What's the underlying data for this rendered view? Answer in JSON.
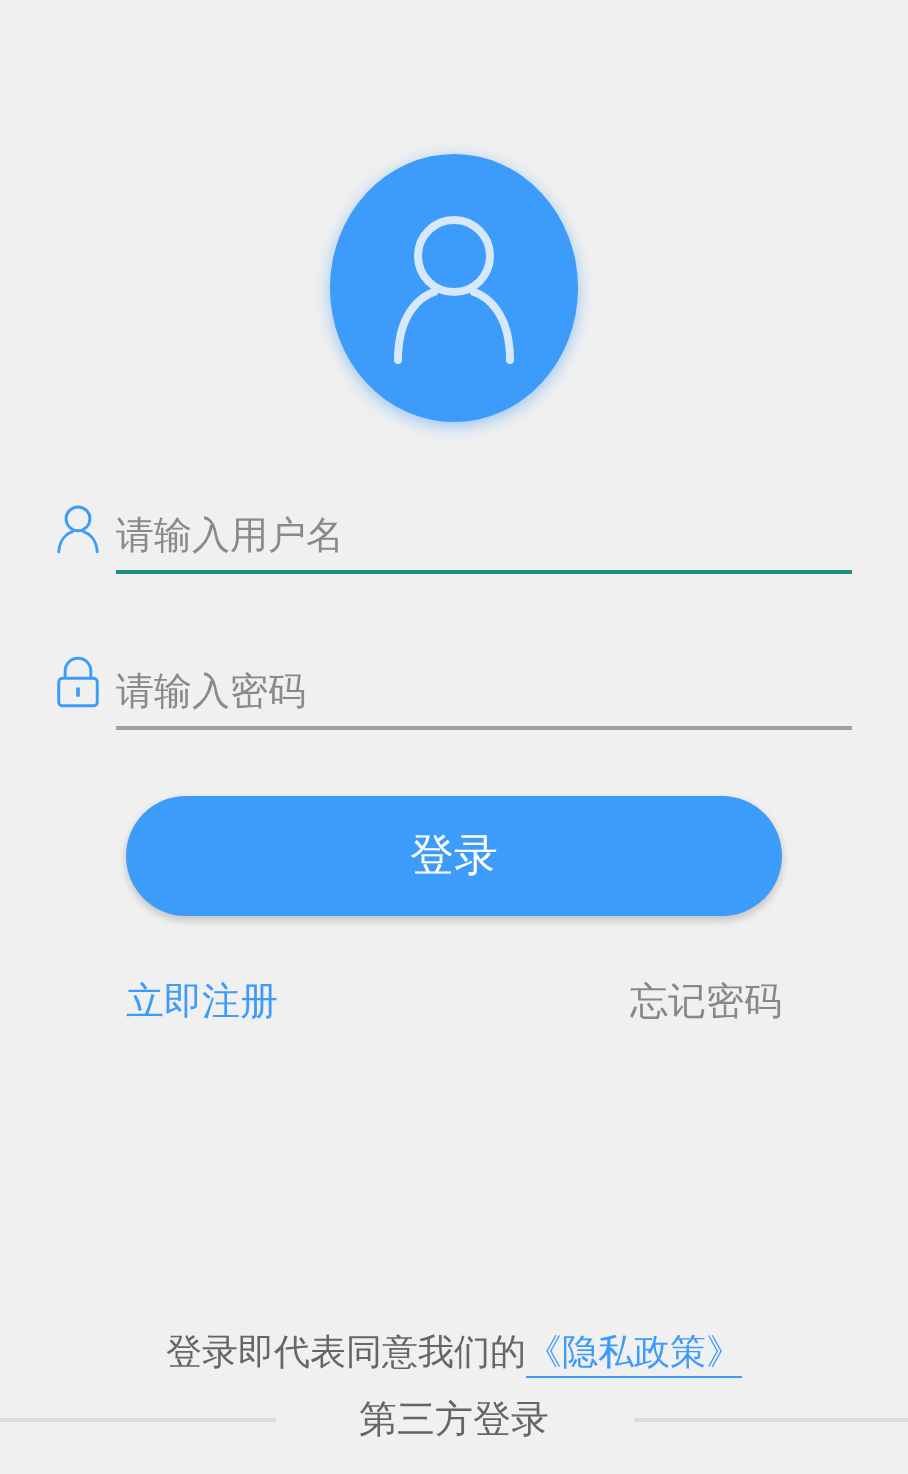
{
  "fields": [
    {
      "kind": "user",
      "placeholder": "请输入用户名",
      "focused": true
    },
    {
      "kind": "lock",
      "placeholder": "请输入密码",
      "focused": false
    }
  ],
  "login_button": "登录",
  "register_link": "立即注册",
  "forgot_link": "忘记密码",
  "agreement": {
    "text": "登录即代表同意我们的",
    "link": "《隐私政策》"
  },
  "third_party": "第三方登录"
}
